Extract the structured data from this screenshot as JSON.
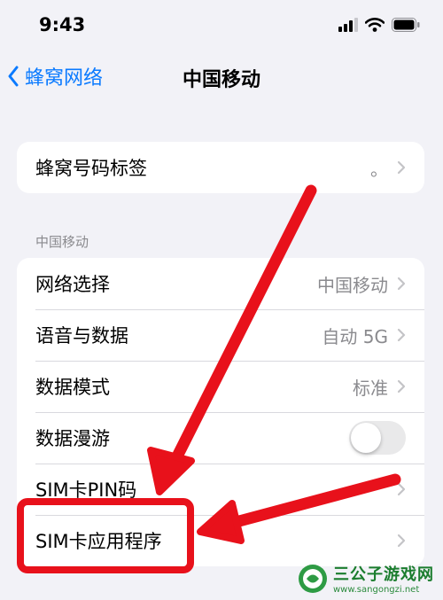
{
  "status_bar": {
    "time": "9:43"
  },
  "nav": {
    "back_label": "蜂窝网络",
    "title": "中国移动"
  },
  "group1": {
    "rows": [
      {
        "label": "蜂窝号码标签",
        "value": "。"
      }
    ]
  },
  "section_header": "中国移动",
  "group2": {
    "rows": [
      {
        "label": "网络选择",
        "value": "中国移动"
      },
      {
        "label": "语音与数据",
        "value": "自动 5G"
      },
      {
        "label": "数据模式",
        "value": "标准"
      },
      {
        "label": "数据漫游",
        "toggle": false
      },
      {
        "label": "SIM卡PIN码",
        "value": ""
      },
      {
        "label": "SIM卡应用程序",
        "value": ""
      }
    ]
  },
  "annotation": {
    "arrow_color": "#e8111b",
    "highlighted_row": "SIM卡应用程序"
  },
  "watermark": {
    "title": "三公子游戏网",
    "url": "www.sangongzi.net"
  },
  "colors": {
    "accent": "#0a7aff",
    "background": "#f2f2f7",
    "secondary_text": "#8a8a8e",
    "annotation_red": "#e8111b"
  }
}
